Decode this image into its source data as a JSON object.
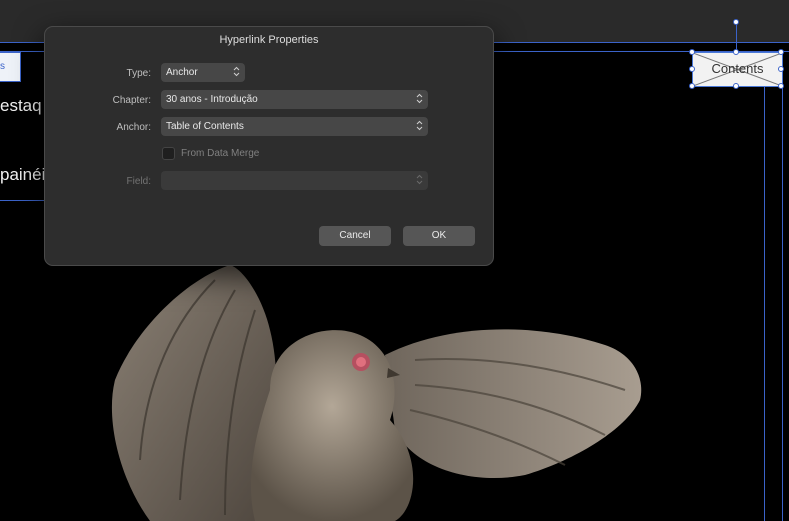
{
  "dialog": {
    "title": "Hyperlink Properties",
    "type_label": "Type:",
    "type_value": "Anchor",
    "chapter_label": "Chapter:",
    "chapter_value": "30 anos - Introdução",
    "anchor_label": "Anchor:",
    "anchor_value": "Table of Contents",
    "from_data_merge_label": "From Data Merge",
    "from_data_merge_checked": false,
    "field_label": "Field:",
    "field_value": "",
    "cancel_label": "Cancel",
    "ok_label": "OK"
  },
  "canvas": {
    "left_frame_text": "s",
    "left_text_1": "estaq",
    "left_text_2": "painéi",
    "contents_frame_text": "Contents"
  },
  "colors": {
    "dialog_bg": "#2d2d2d",
    "selection_blue": "#3b63c9",
    "canvas_bg": "#000000"
  }
}
